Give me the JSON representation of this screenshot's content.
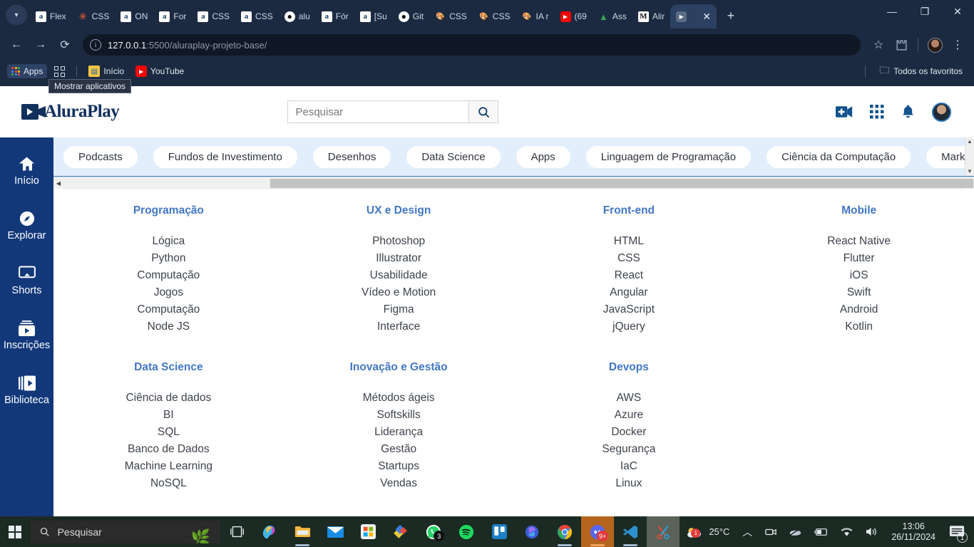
{
  "browser": {
    "tabs": [
      {
        "label": "Flex",
        "icon": "alura-favicon"
      },
      {
        "label": "CSS",
        "icon": "css-favicon"
      },
      {
        "label": "ON",
        "icon": "alura-favicon"
      },
      {
        "label": "For",
        "icon": "alura-favicon"
      },
      {
        "label": "CSS",
        "icon": "alura-favicon"
      },
      {
        "label": "CSS",
        "icon": "alura-favicon"
      },
      {
        "label": "alu",
        "icon": "github-favicon"
      },
      {
        "label": "Fór",
        "icon": "alura-favicon"
      },
      {
        "label": "[Su",
        "icon": "alura-favicon"
      },
      {
        "label": "Git",
        "icon": "github-favicon"
      },
      {
        "label": "CSS",
        "icon": "figma-favicon"
      },
      {
        "label": "CSS",
        "icon": "figma-favicon"
      },
      {
        "label": "IA r",
        "icon": "figma-favicon"
      },
      {
        "label": "(69",
        "icon": "youtube-favicon"
      },
      {
        "label": "Ass",
        "icon": "google-drive-favicon"
      },
      {
        "label": "Alir",
        "icon": "medium-favicon"
      }
    ],
    "active_tab": {
      "label": "",
      "icon": "live-server-favicon",
      "close": "✕"
    },
    "new_tab_label": "+",
    "window_controls": {
      "minimize": "—",
      "maximize": "❐",
      "close": "✕"
    },
    "omnibox": {
      "domain": "127.0.0.1",
      "path": ":5500/aluraplay-projeto-base/"
    },
    "bookmarks": {
      "apps_label": "Apps",
      "items": [
        {
          "label": "Início",
          "icon": "contacts-icon"
        },
        {
          "label": "YouTube",
          "icon": "youtube-icon"
        }
      ],
      "all_bookmarks_label": "Todos os favoritos"
    },
    "tooltip": "Mostrar aplicativos"
  },
  "site": {
    "brand": "AluraPlay",
    "search": {
      "placeholder": "Pesquisar",
      "value": ""
    },
    "header_icons": [
      "video-add-icon",
      "apps-grid-icon",
      "bell-icon",
      "avatar"
    ],
    "sidebar": [
      {
        "label": "Início",
        "icon": "home-icon"
      },
      {
        "label": "Explorar",
        "icon": "compass-icon"
      },
      {
        "label": "Shorts",
        "icon": "shorts-icon"
      },
      {
        "label": "Inscrições",
        "icon": "subscriptions-icon"
      },
      {
        "label": "Biblioteca",
        "icon": "library-icon"
      }
    ],
    "nav_pills": [
      "Podcasts",
      "Fundos de Investimento",
      "Desenhos",
      "Data Science",
      "Apps",
      "Linguagem de Programação",
      "Ciência da Computação",
      "Marketing"
    ],
    "categories_row1": [
      {
        "title": "Programação",
        "items": [
          "Lógica",
          "Python",
          "Computação",
          "Jogos",
          "Computação",
          "Node JS"
        ]
      },
      {
        "title": "UX e Design",
        "items": [
          "Photoshop",
          "Illustrator",
          "Usabilidade",
          "Vídeo e Motion",
          "Figma",
          "Interface"
        ]
      },
      {
        "title": "Front-end",
        "items": [
          "HTML",
          "CSS",
          "React",
          "Angular",
          "JavaScript",
          "jQuery"
        ]
      },
      {
        "title": "Mobile",
        "items": [
          "React Native",
          "Flutter",
          "iOS",
          "Swift",
          "Android",
          "Kotlin"
        ]
      }
    ],
    "categories_row2": [
      {
        "title": "Data Science",
        "items": [
          "Ciência de dados",
          "BI",
          "SQL",
          "Banco de Dados",
          "Machine Learning",
          "NoSQL"
        ]
      },
      {
        "title": "Inovação e Gestão",
        "items": [
          "Métodos ágeis",
          "Softskills",
          "Liderança",
          "Gestão",
          "Startups",
          "Vendas"
        ]
      },
      {
        "title": "Devops",
        "items": [
          "AWS",
          "Azure",
          "Docker",
          "Segurança",
          "IaC",
          "Linux"
        ]
      },
      {
        "title": "",
        "items": []
      }
    ]
  },
  "taskbar": {
    "search_placeholder": "Pesquisar",
    "apps": [
      {
        "name": "task-view-icon",
        "badge": ""
      },
      {
        "name": "copilot-icon",
        "badge": ""
      },
      {
        "name": "file-explorer-icon",
        "badge": ""
      },
      {
        "name": "mail-icon",
        "badge": ""
      },
      {
        "name": "microsoft-store-icon",
        "badge": ""
      },
      {
        "name": "paint-icon",
        "badge": ""
      },
      {
        "name": "whatsapp-icon",
        "badge": "3"
      },
      {
        "name": "spotify-icon",
        "badge": ""
      },
      {
        "name": "trello-icon",
        "badge": ""
      },
      {
        "name": "microsoft-365-icon",
        "badge": ""
      },
      {
        "name": "chrome-icon",
        "badge": ""
      },
      {
        "name": "discord-icon",
        "badge": "9+"
      },
      {
        "name": "vscode-icon",
        "badge": ""
      },
      {
        "name": "snipping-tool-icon",
        "badge": ""
      }
    ],
    "weather": {
      "temperature": "25°C",
      "alert_count": "1"
    },
    "clock": {
      "time": "13:06",
      "date": "26/11/2024"
    },
    "notification_count": "1"
  },
  "colors": {
    "brand_navy": "#11305e",
    "sidebar_blue": "#12387a",
    "heading_blue": "#4277c6",
    "nav_bg": "#e3eefc"
  }
}
